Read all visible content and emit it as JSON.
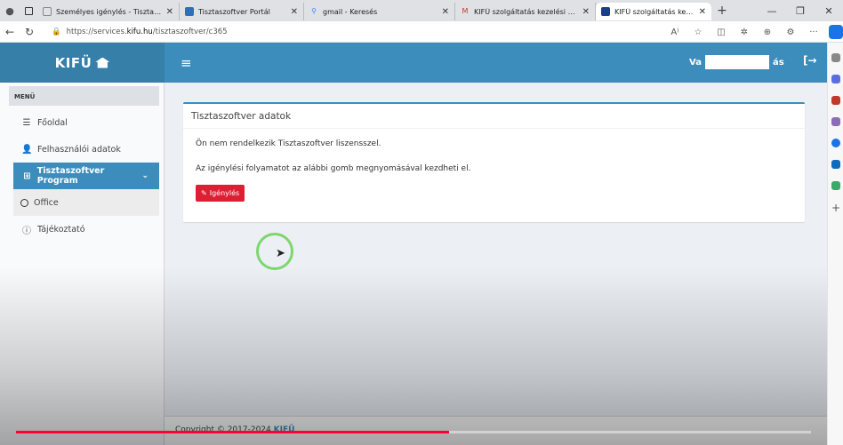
{
  "browser": {
    "tabs": [
      {
        "title": "Személyes igénylés - Tisztaszoftver",
        "color": "#888888"
      },
      {
        "title": "Tisztaszoftver Portál",
        "color": "#2e6fb7"
      },
      {
        "title": "gmail - Keresés",
        "color": "#4285f4"
      },
      {
        "title": "KIFÜ szolgáltatás kezelési oldal",
        "color": "#d93025"
      },
      {
        "title": "KIFÜ szolgáltatás kezelési oldal",
        "color": "#1a3f8a",
        "active": true
      }
    ],
    "new_tab": "+",
    "window_controls": {
      "minimize": "—",
      "restore": "❐",
      "close": "✕"
    },
    "url_prefix": "https://services.",
    "url_domain": "kifu.hu",
    "url_path": "/tisztaszoftver/c365",
    "address_icons": [
      "A⁾",
      "☆",
      "◫",
      "✲",
      "⊕",
      "⚙",
      "···"
    ]
  },
  "app": {
    "logo_text": "KIFÜ",
    "user_prefix": "Va",
    "user_suffix": "ás",
    "logout": "[→"
  },
  "sidebar": {
    "menu_header": "MENÜ",
    "items": [
      {
        "label": "Főoldal",
        "icon": "list-icon",
        "glyph": "☰"
      },
      {
        "label": "Felhasználói adatok",
        "icon": "user-icon",
        "glyph": "👤"
      },
      {
        "label": "Tisztaszoftver Program",
        "icon": "windows-icon",
        "glyph": "⊞",
        "chevron": "⌄"
      },
      {
        "label": "Office",
        "icon": "circle-icon"
      },
      {
        "label": "Tájékoztató",
        "icon": "info-icon",
        "glyph": "ⓘ"
      }
    ]
  },
  "content": {
    "box_title": "Tisztaszoftver adatok",
    "notice": "Ön nem rendelkezik Tisztaszoftver liszensszel.",
    "instruction": "Az igénylési folyamatot az alábbi gomb megnyomásával kezdheti el.",
    "button_label": "Igénylés",
    "button_glyph": "✎"
  },
  "footer": {
    "text": "Copyright © 2017-2024 ",
    "brand": "KIFÜ"
  },
  "video": {
    "progress": 0.545
  },
  "colors": {
    "header_dark": "#367fa9",
    "header": "#3c8dbc",
    "button_red": "#dd1f34",
    "progress_red": "#ff0033"
  }
}
